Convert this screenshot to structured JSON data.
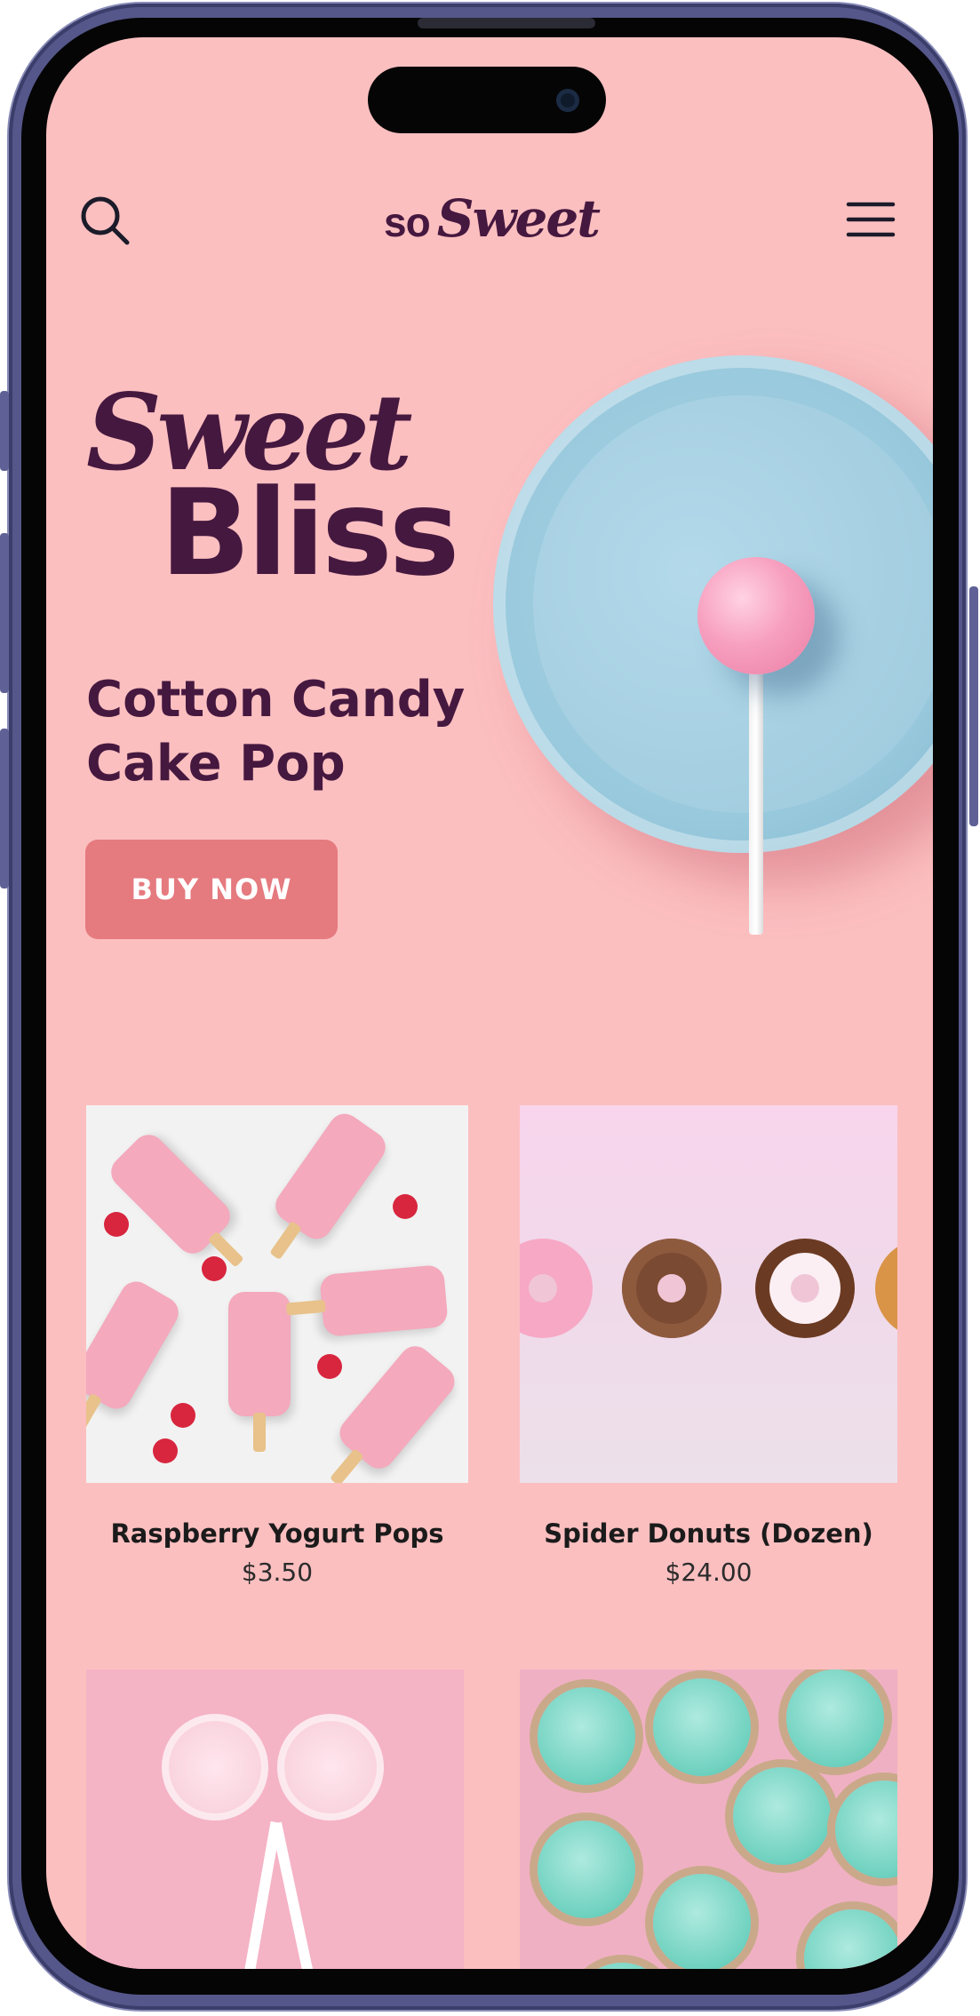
{
  "header": {
    "logo": {
      "prefix": "so",
      "script": "Sweet"
    }
  },
  "hero": {
    "title_script": "Sweet",
    "title_bold": "Bliss",
    "subtitle": "Cotton Candy\nCake Pop",
    "cta_label": "BUY NOW"
  },
  "products": [
    {
      "name": "Raspberry Yogurt Pops",
      "price": "$3.50"
    },
    {
      "name": "Spider Donuts (Dozen)",
      "price": "$24.00"
    },
    {
      "name": "",
      "price": ""
    },
    {
      "name": "",
      "price": ""
    }
  ],
  "colors": {
    "background": "#fcbfc0",
    "brand": "#45183f",
    "cta": "#e57a7f",
    "frame": "#55578a"
  },
  "icons": {
    "search": "search-icon",
    "menu": "hamburger-menu-icon"
  }
}
